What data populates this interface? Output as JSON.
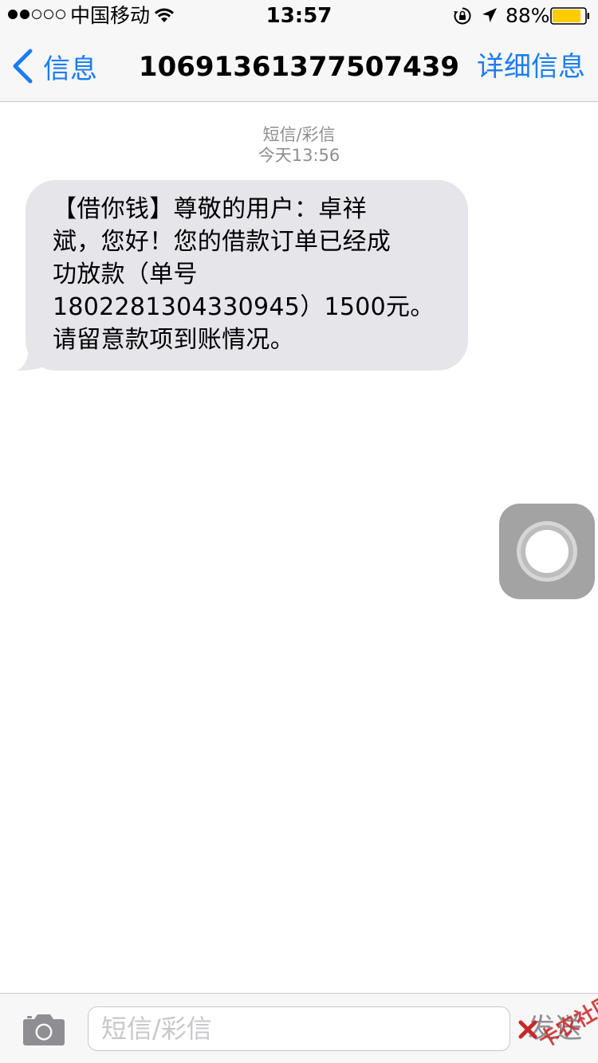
{
  "status_bar": {
    "carrier": "中国移动",
    "time": "13:57",
    "battery_percent": "88%",
    "battery_level": 0.88,
    "battery_color": "#ffcc00",
    "signal_bars_filled": 2,
    "signal_bars_total": 5,
    "icons": [
      "wifi-icon",
      "rotation-lock-icon",
      "location-arrow-icon",
      "battery-icon"
    ]
  },
  "nav": {
    "back_label": "信息",
    "title": "10691361377507439",
    "details_label": "详细信息"
  },
  "conversation": {
    "message_type": "短信/彩信",
    "timestamp": "今天13:56",
    "messages": [
      {
        "direction": "incoming",
        "text": "【借你钱】尊敬的用户：卓祥\n斌，您好！您的借款订单已经成\n功放款（单号\n1802281304330945）1500元。\n请留意款项到账情况。"
      }
    ]
  },
  "input_bar": {
    "placeholder": "短信/彩信",
    "send_label": "发送"
  },
  "watermark": {
    "text": "卡农社区"
  },
  "colors": {
    "accent": "#1a7cf5",
    "bubble_incoming": "#e5e5ea",
    "bar_background": "#f7f7f7",
    "meta_text": "#8e8e93"
  }
}
